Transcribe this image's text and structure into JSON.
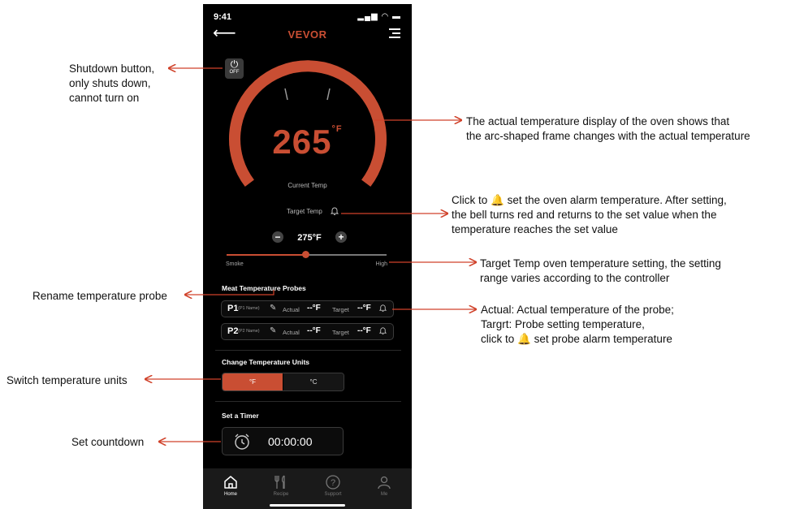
{
  "colors": {
    "accent": "#c94e33",
    "arrow": "#d0422a",
    "phone_bg": "#000000"
  },
  "status": {
    "time": "9:41"
  },
  "app": {
    "brand": "VEVOR"
  },
  "power": {
    "label": "OFF",
    "icon": "power-icon"
  },
  "oven": {
    "current_temp": "265",
    "current_unit": "°F",
    "current_label": "Current Temp",
    "target_label": "Target Temp",
    "target_value": "275°F",
    "slider_min": "Smoke",
    "slider_max": "High",
    "slider_position": 0.49
  },
  "probes": {
    "title": "Meat Temperature Probes",
    "items": [
      {
        "id": "P1",
        "name": "(P1 Name)",
        "actual_label": "Actual",
        "actual_value": "--°F",
        "target_label": "Target",
        "target_value": "--°F"
      },
      {
        "id": "P2",
        "name": "(P2 Name)",
        "actual_label": "Actual",
        "actual_value": "--°F",
        "target_label": "Target",
        "target_value": "--°F"
      }
    ]
  },
  "units": {
    "title": "Change Temperature Units",
    "fahrenheit": "°F",
    "celsius": "°C",
    "selected": "°F"
  },
  "timer": {
    "title": "Set a Timer",
    "value": "00:00:00"
  },
  "tabs": [
    {
      "label": "Home",
      "icon": "home-icon"
    },
    {
      "label": "Recipe",
      "icon": "utensils-icon"
    },
    {
      "label": "Support",
      "icon": "help-icon"
    },
    {
      "label": "Me",
      "icon": "user-icon"
    }
  ],
  "annotations": {
    "shutdown": [
      "Shutdown button,",
      "only shuts down,",
      "cannot turn on"
    ],
    "actual_display": [
      "The actual temperature display of the oven shows that",
      "the arc-shaped frame changes with the actual temperature"
    ],
    "alarm": [
      "Click to",
      "set the oven alarm temperature. After setting,",
      "the bell turns red and returns to the set value when the",
      "temperature reaches the set value"
    ],
    "target_setting": [
      "Target Temp oven temperature setting, the setting",
      "range varies according to the controller"
    ],
    "rename": "Rename temperature probe",
    "probe_info": [
      "Actual:  Actual temperature of the probe;",
      "Targrt:  Probe setting temperature,",
      "click to",
      "set probe alarm temperature"
    ],
    "switch_units": "Switch temperature units",
    "countdown": "Set countdown"
  }
}
